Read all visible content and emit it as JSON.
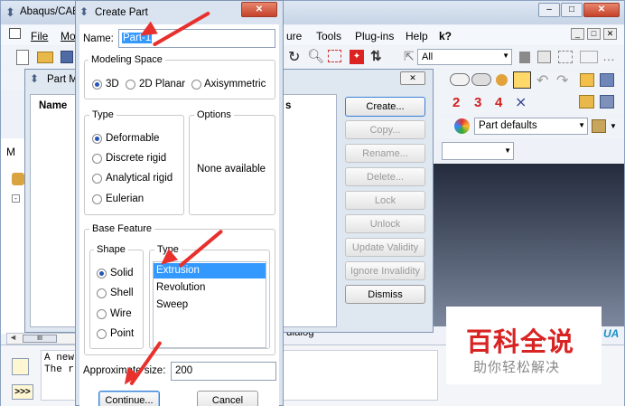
{
  "main_window": {
    "title": "Abaqus/CAE",
    "menu": [
      "File",
      "Mo",
      "ure",
      "Tools",
      "Plug-ins",
      "Help",
      "k?"
    ],
    "filter_value": "All",
    "numbers": [
      "2",
      "3",
      "4"
    ],
    "part_defaults": "Part defaults",
    "status_partial": "dialog",
    "msg_line1": "A new",
    "msg_line2": "The r",
    "side_tab": "M",
    "tree_collapsed": "⊞",
    "nav_left": "◄",
    "scroll_thumb": "III",
    "prompt": ">>>"
  },
  "part_manager": {
    "title": "Part M",
    "column_name": "Name",
    "close_glyph": "✕",
    "col_s": "s",
    "buttons": [
      "Create...",
      "Copy...",
      "Rename...",
      "Delete...",
      "Lock",
      "Unlock",
      "Update Validity",
      "Ignore Invalidity",
      "Dismiss"
    ],
    "enabled": [
      true,
      false,
      false,
      false,
      false,
      false,
      false,
      false,
      true
    ]
  },
  "create_part": {
    "title": "Create Part",
    "name_label": "Name:",
    "name_value": "Part-1",
    "modeling_space_label": "Modeling Space",
    "modeling_space_options": [
      "3D",
      "2D Planar",
      "Axisymmetric"
    ],
    "modeling_space_selected": "3D",
    "type_label": "Type",
    "type_options": [
      "Deformable",
      "Discrete rigid",
      "Analytical rigid",
      "Eulerian"
    ],
    "type_selected": "Deformable",
    "options_label": "Options",
    "options_text": "None available",
    "base_feature_label": "Base Feature",
    "shape_label": "Shape",
    "shape_options": [
      "Solid",
      "Shell",
      "Wire",
      "Point"
    ],
    "shape_selected": "Solid",
    "bf_type_label": "Type",
    "bf_type_list": [
      "Extrusion",
      "Revolution",
      "Sweep"
    ],
    "bf_type_selected": "Extrusion",
    "approx_size_label": "Approximate size:",
    "approx_size_value": "200",
    "continue_label": "Continue...",
    "cancel_label": "Cancel"
  },
  "watermark": {
    "line1": "百科全说",
    "line2": "助你轻松解决",
    "edge_text": "UA"
  },
  "colors": {
    "title_bar": "#cfdcec",
    "selection": "#3399ff",
    "annotation": "#e8302c",
    "viewport_top": "#232b3c",
    "viewport_bottom": "#7c879d",
    "watermark_red": "#d82323"
  }
}
